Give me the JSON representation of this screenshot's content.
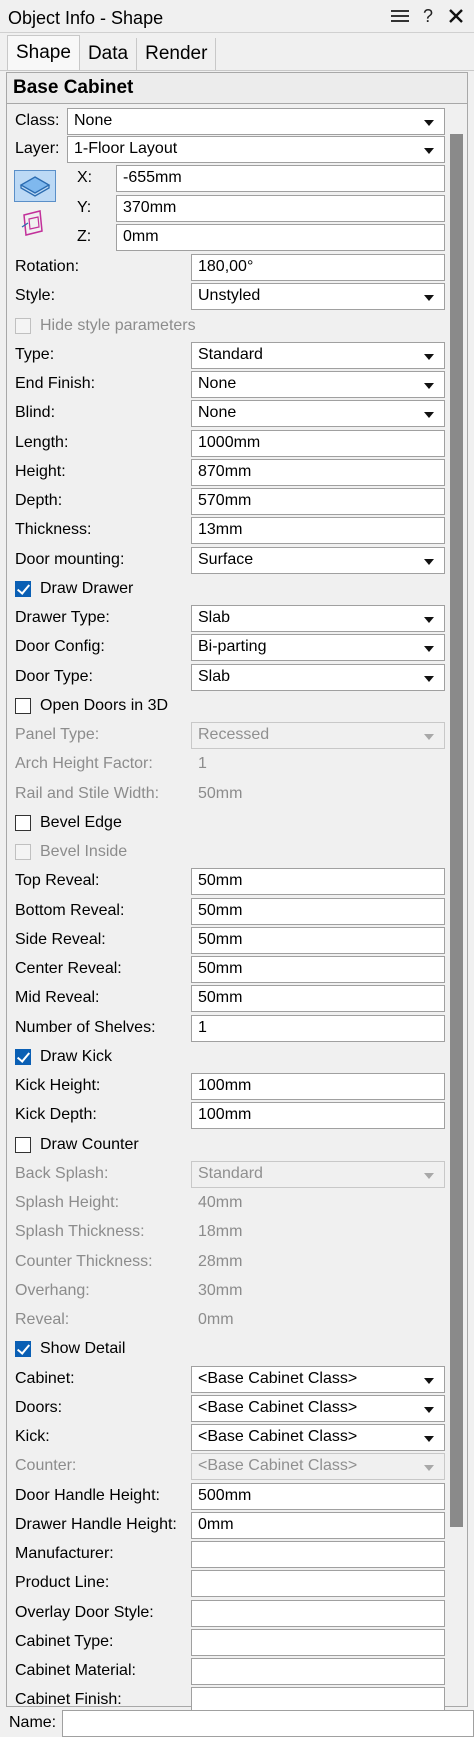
{
  "window": {
    "title": "Object Info - Shape",
    "icons": [
      "menu-icon",
      "help-icon",
      "close-icon"
    ]
  },
  "tabs": [
    "Shape",
    "Data",
    "Render"
  ],
  "object_type": "Base Cabinet",
  "general": {
    "class_label": "Class:",
    "class_value": "None",
    "layer_label": "Layer:",
    "layer_value": "1-Floor Layout",
    "x_label": "X:",
    "x_value": "-655mm",
    "y_label": "Y:",
    "y_value": "370mm",
    "z_label": "Z:",
    "z_value": "0mm"
  },
  "params": [
    {
      "label": "Rotation:",
      "value": "180,00°",
      "kind": "text"
    },
    {
      "label": "Style:",
      "value": "Unstyled",
      "kind": "dropdown"
    },
    {
      "label": "Hide style parameters",
      "kind": "check",
      "checked": false,
      "disabled": true
    },
    {
      "label": "Type:",
      "value": "Standard",
      "kind": "dropdown"
    },
    {
      "label": "End Finish:",
      "value": "None",
      "kind": "dropdown"
    },
    {
      "label": "Blind:",
      "value": "None",
      "kind": "dropdown"
    },
    {
      "label": "Length:",
      "value": "1000mm",
      "kind": "text"
    },
    {
      "label": "Height:",
      "value": "870mm",
      "kind": "text"
    },
    {
      "label": "Depth:",
      "value": "570mm",
      "kind": "text"
    },
    {
      "label": "Thickness:",
      "value": "13mm",
      "kind": "text"
    },
    {
      "label": "Door mounting:",
      "value": "Surface",
      "kind": "dropdown"
    },
    {
      "label": "Draw Drawer",
      "kind": "check",
      "checked": true
    },
    {
      "label": "Drawer Type:",
      "value": "Slab",
      "kind": "dropdown"
    },
    {
      "label": "Door Config:",
      "value": "Bi-parting",
      "kind": "dropdown"
    },
    {
      "label": "Door Type:",
      "value": "Slab",
      "kind": "dropdown"
    },
    {
      "label": "Open Doors in 3D",
      "kind": "check",
      "checked": false
    },
    {
      "label": "Panel Type:",
      "value": "Recessed",
      "kind": "dropdown",
      "disabled": true
    },
    {
      "label": "Arch Height Factor:",
      "value": "1",
      "kind": "plain",
      "disabled": true
    },
    {
      "label": "Rail and Stile Width:",
      "value": "50mm",
      "kind": "plain",
      "disabled": true
    },
    {
      "label": "Bevel Edge",
      "kind": "check",
      "checked": false
    },
    {
      "label": "Bevel Inside",
      "kind": "check",
      "checked": false,
      "disabled": true
    },
    {
      "label": "Top Reveal:",
      "value": "50mm",
      "kind": "text"
    },
    {
      "label": "Bottom Reveal:",
      "value": "50mm",
      "kind": "text"
    },
    {
      "label": "Side Reveal:",
      "value": "50mm",
      "kind": "text"
    },
    {
      "label": "Center Reveal:",
      "value": "50mm",
      "kind": "text"
    },
    {
      "label": "Mid Reveal:",
      "value": "50mm",
      "kind": "text"
    },
    {
      "label": "Number of Shelves:",
      "value": "1",
      "kind": "text"
    },
    {
      "label": "Draw Kick",
      "kind": "check",
      "checked": true
    },
    {
      "label": "Kick Height:",
      "value": "100mm",
      "kind": "text"
    },
    {
      "label": "Kick Depth:",
      "value": "100mm",
      "kind": "text"
    },
    {
      "label": "Draw Counter",
      "kind": "check",
      "checked": false
    },
    {
      "label": "Back Splash:",
      "value": "Standard",
      "kind": "dropdown",
      "disabled": true
    },
    {
      "label": "Splash Height:",
      "value": "40mm",
      "kind": "plain",
      "disabled": true
    },
    {
      "label": "Splash Thickness:",
      "value": "18mm",
      "kind": "plain",
      "disabled": true
    },
    {
      "label": "Counter Thickness:",
      "value": "28mm",
      "kind": "plain",
      "disabled": true
    },
    {
      "label": "Overhang:",
      "value": "30mm",
      "kind": "plain",
      "disabled": true
    },
    {
      "label": "Reveal:",
      "value": "0mm",
      "kind": "plain",
      "disabled": true
    },
    {
      "label": "Show Detail",
      "kind": "check",
      "checked": true
    },
    {
      "label": "Cabinet:",
      "value": "<Base Cabinet Class>",
      "kind": "dropdown"
    },
    {
      "label": "Doors:",
      "value": "<Base Cabinet Class>",
      "kind": "dropdown"
    },
    {
      "label": "Kick:",
      "value": "<Base Cabinet Class>",
      "kind": "dropdown"
    },
    {
      "label": "Counter:",
      "value": "<Base Cabinet Class>",
      "kind": "dropdown",
      "disabled": true
    },
    {
      "label": "Door Handle Height:",
      "value": "500mm",
      "kind": "text"
    },
    {
      "label": "Drawer Handle Height:",
      "value": "0mm",
      "kind": "text"
    },
    {
      "label": "Manufacturer:",
      "value": "",
      "kind": "text"
    },
    {
      "label": "Product Line:",
      "value": "",
      "kind": "text"
    },
    {
      "label": "Overlay Door Style:",
      "value": "",
      "kind": "text"
    },
    {
      "label": "Cabinet Type:",
      "value": "",
      "kind": "text"
    },
    {
      "label": "Cabinet Material:",
      "value": "",
      "kind": "text"
    },
    {
      "label": "Cabinet Finish:",
      "value": "",
      "kind": "text"
    }
  ],
  "name_field": {
    "label": "Name:",
    "value": ""
  }
}
